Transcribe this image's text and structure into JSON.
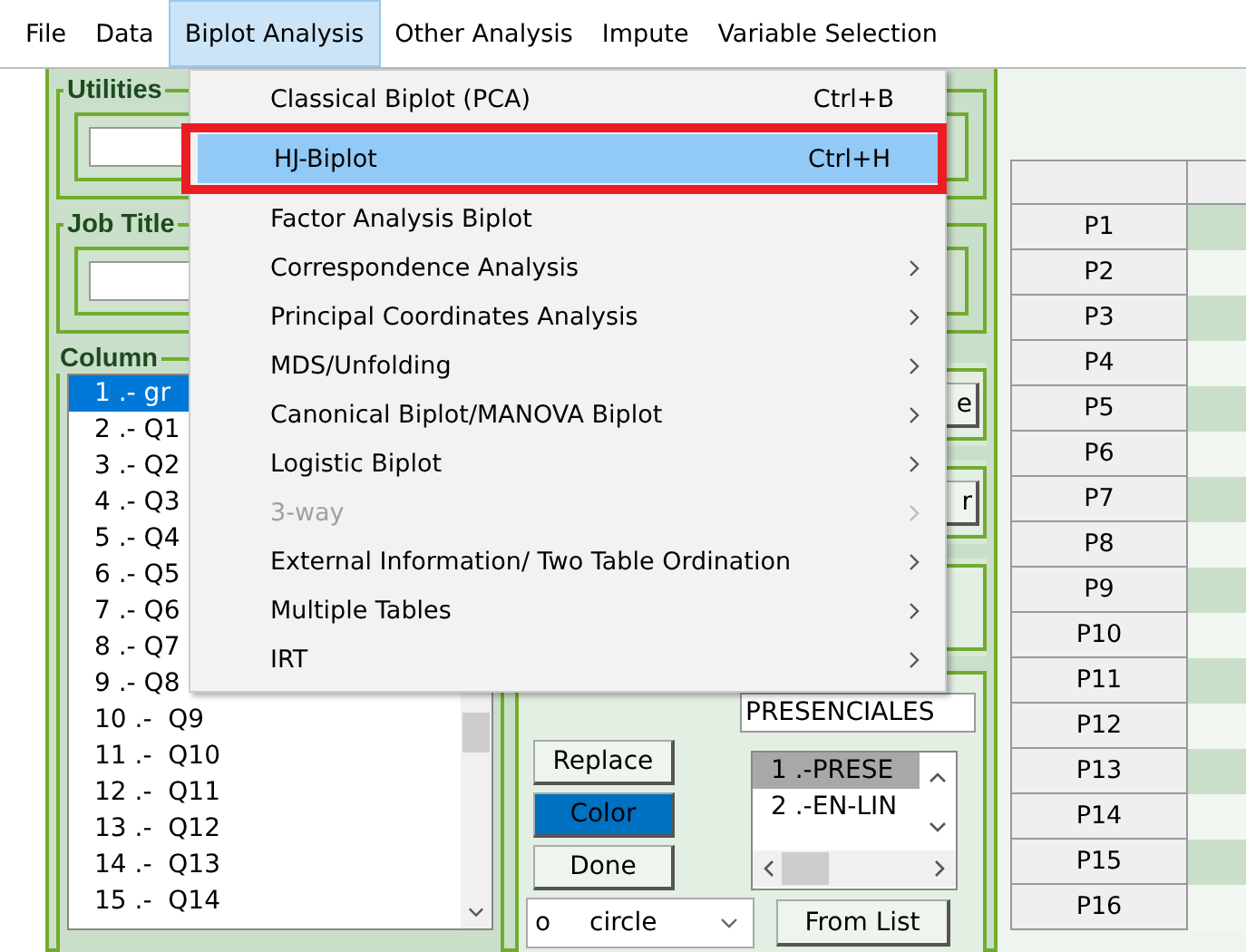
{
  "menubar": [
    {
      "label": "File",
      "selected": false
    },
    {
      "label": "Data",
      "selected": false
    },
    {
      "label": "Biplot Analysis",
      "selected": true
    },
    {
      "label": "Other Analysis",
      "selected": false
    },
    {
      "label": "Impute",
      "selected": false
    },
    {
      "label": "Variable Selection",
      "selected": false
    }
  ],
  "dropdown_menu": [
    {
      "label": "Classical Biplot (PCA)",
      "shortcut": "Ctrl+B",
      "submenu": false,
      "disabled": false,
      "selected": false
    },
    {
      "label": "HJ-Biplot",
      "shortcut": "Ctrl+H",
      "submenu": false,
      "disabled": false,
      "selected": true,
      "highlighted": true
    },
    {
      "label": "Factor Analysis Biplot",
      "submenu": false,
      "disabled": false,
      "selected": false
    },
    {
      "label": "Correspondence Analysis",
      "submenu": true,
      "disabled": false,
      "selected": false
    },
    {
      "label": "Principal Coordinates Analysis",
      "submenu": true,
      "disabled": false,
      "selected": false
    },
    {
      "label": "MDS/Unfolding",
      "submenu": true,
      "disabled": false,
      "selected": false
    },
    {
      "label": "Canonical Biplot/MANOVA Biplot",
      "submenu": true,
      "disabled": false,
      "selected": false
    },
    {
      "label": "Logistic Biplot",
      "submenu": true,
      "disabled": false,
      "selected": false
    },
    {
      "label": "3-way",
      "submenu": true,
      "disabled": true,
      "selected": false
    },
    {
      "label": "External Information/ Two Table Ordination",
      "submenu": true,
      "disabled": false,
      "selected": false
    },
    {
      "label": "Multiple Tables",
      "submenu": true,
      "disabled": false,
      "selected": false
    },
    {
      "label": "IRT",
      "submenu": true,
      "disabled": false,
      "selected": false
    }
  ],
  "utilities": {
    "title": "Utilities"
  },
  "job_title": {
    "title": "Job Title"
  },
  "column": {
    "title": "Column",
    "items": [
      {
        "label": "1 .- gr",
        "selected": true
      },
      {
        "label": "2 .- Q1",
        "selected": false
      },
      {
        "label": "3 .- Q2",
        "selected": false
      },
      {
        "label": "4 .- Q3",
        "selected": false
      },
      {
        "label": "5 .- Q4",
        "selected": false
      },
      {
        "label": "6 .- Q5",
        "selected": false
      },
      {
        "label": "7 .- Q6",
        "selected": false
      },
      {
        "label": "8 .- Q7",
        "selected": false
      },
      {
        "label": "9 .- Q8",
        "selected": false
      },
      {
        "label": "10 .-  Q9",
        "selected": false
      },
      {
        "label": "11 .-  Q10",
        "selected": false
      },
      {
        "label": "12 .-  Q11",
        "selected": false
      },
      {
        "label": "13 .-  Q12",
        "selected": false
      },
      {
        "label": "14 .-  Q13",
        "selected": false
      },
      {
        "label": "15 .-  Q14",
        "selected": false
      }
    ]
  },
  "side_buttons": [
    "e",
    "r"
  ],
  "group_name": {
    "value": "PRESENCIALES"
  },
  "buttons": [
    {
      "label": "Replace",
      "selected": false
    },
    {
      "label": "Color",
      "selected": true
    },
    {
      "label": "Done",
      "selected": false
    }
  ],
  "symbol_select": {
    "symbol": "o",
    "value": "circle"
  },
  "groups_list": [
    {
      "label": "1 .-PRESE",
      "selected": true
    },
    {
      "label": "2 .-EN-LIN",
      "selected": false
    }
  ],
  "from_list_button": "From List",
  "table": {
    "rows": [
      "P1",
      "P2",
      "P3",
      "P4",
      "P5",
      "P6",
      "P7",
      "P8",
      "P9",
      "P10",
      "P11",
      "P12",
      "P13",
      "P14",
      "P15",
      "P16"
    ]
  }
}
